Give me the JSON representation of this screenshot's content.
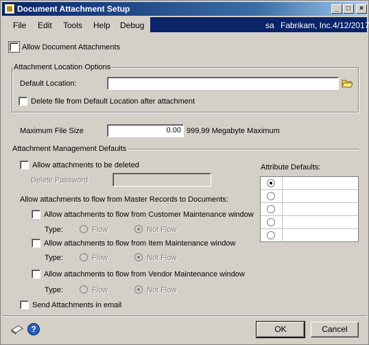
{
  "window": {
    "title": "Document Attachment Setup"
  },
  "menu": {
    "items": [
      "File",
      "Edit",
      "Tools",
      "Help",
      "Debug"
    ],
    "user": "sa",
    "company": "Fabrikam, Inc.",
    "date": "4/12/2017"
  },
  "allow_doc_attachments": {
    "label": "Allow Document Attachments",
    "checked": false
  },
  "location_options": {
    "title": "Attachment Location Options",
    "default_location_label": "Default Location:",
    "default_location_value": "",
    "delete_file_label": "Delete file from Default Location after attachment",
    "delete_file_checked": false
  },
  "max_file_size": {
    "label": "Maximum File Size",
    "value": "0.00",
    "hint": "999.99 Megabyte Maximum"
  },
  "management": {
    "title": "Attachment Management Defaults",
    "allow_delete_label": "Allow attachments to be deleted",
    "allow_delete_checked": false,
    "delete_password_label": "Delete Password",
    "delete_password_value": "",
    "flow_heading": "Allow attachments to flow from Master Records to Documents:",
    "type_label": "Type:",
    "flow_label": "Flow",
    "not_flow_label": "Not Flow",
    "flows": [
      {
        "label": "Allow attachments to flow from Customer Maintenance window",
        "checked": false,
        "selected": "Not Flow"
      },
      {
        "label": "Allow attachments to flow from Item Maintenance window",
        "checked": false,
        "selected": "Not Flow"
      },
      {
        "label": "Allow attachments to flow from Vendor Maintenance window",
        "checked": false,
        "selected": "Not Flow"
      }
    ],
    "send_email_label": "Send Attachments in email",
    "send_email_checked": false
  },
  "attribute_defaults": {
    "label": "Attribute Defaults:",
    "rows": [
      {
        "selected": true,
        "value": ""
      },
      {
        "selected": false,
        "value": ""
      },
      {
        "selected": false,
        "value": ""
      },
      {
        "selected": false,
        "value": ""
      },
      {
        "selected": false,
        "value": ""
      }
    ]
  },
  "buttons": {
    "ok": "OK",
    "cancel": "Cancel"
  },
  "icons": {
    "note": "note-icon",
    "help": "help-icon",
    "folder": "folder-icon"
  }
}
